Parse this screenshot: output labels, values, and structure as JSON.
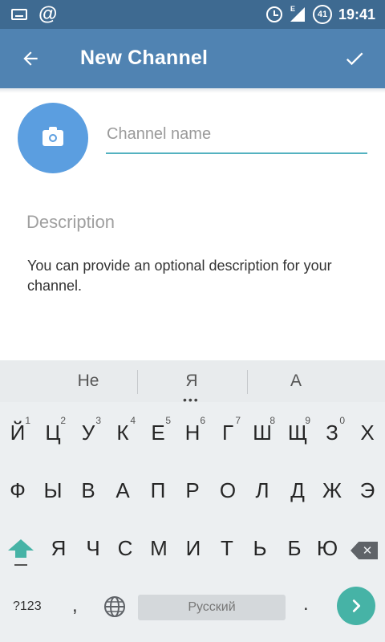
{
  "status_bar": {
    "icons": [
      "keyboard-icon",
      "at-icon",
      "alarm-icon",
      "signal-icon",
      "battery-icon"
    ],
    "network_type": "E",
    "battery_level": "41",
    "time": "19:41"
  },
  "action_bar": {
    "title": "New Channel",
    "back_icon": "arrow-back-icon",
    "done_icon": "check-icon",
    "color": "#5083b2"
  },
  "form": {
    "channel_name_placeholder": "Channel name",
    "channel_name_value": "",
    "description_placeholder": "Description",
    "description_value": "",
    "hint": "You can provide an optional description for your channel.",
    "avatar_icon": "camera-icon",
    "accent_color": "#54b2c0"
  },
  "keyboard": {
    "suggestions": [
      "Не",
      "Я",
      "А"
    ],
    "row1": [
      {
        "key": "Й",
        "hint": "1"
      },
      {
        "key": "Ц",
        "hint": "2"
      },
      {
        "key": "У",
        "hint": "3"
      },
      {
        "key": "К",
        "hint": "4"
      },
      {
        "key": "Е",
        "hint": "5"
      },
      {
        "key": "Н",
        "hint": "6"
      },
      {
        "key": "Г",
        "hint": "7"
      },
      {
        "key": "Ш",
        "hint": "8"
      },
      {
        "key": "Щ",
        "hint": "9"
      },
      {
        "key": "З",
        "hint": "0"
      },
      {
        "key": "Х",
        "hint": ""
      }
    ],
    "row2": [
      "Ф",
      "Ы",
      "В",
      "А",
      "П",
      "Р",
      "О",
      "Л",
      "Д",
      "Ж",
      "Э"
    ],
    "row3": [
      "Я",
      "Ч",
      "С",
      "М",
      "И",
      "Т",
      "Ь",
      "Б",
      "Ю"
    ],
    "symbols_key": "?123",
    "comma_key": ",",
    "space_label": "Русский",
    "period_key": ".",
    "accent_color": "#46b3a6"
  }
}
